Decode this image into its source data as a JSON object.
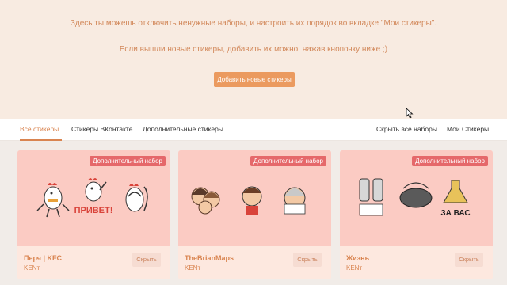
{
  "banner": {
    "line1": "Здесь ты можешь отключить ненужные наборы, и настроить их порядок во вкладке \"Мои стикеры\".",
    "line2": "Если вышли новые стикеры, добавить их можно, нажав кнопочку ниже ;)",
    "add_button": "Добавить новые стикеры"
  },
  "tabs": {
    "all": "Все стикеры",
    "vk": "Стикеры ВКонтакте",
    "extra": "Дополнительные стикеры",
    "hide_all": "Скрыть все наборы",
    "my": "Мои Стикеры"
  },
  "cards": [
    {
      "badge": "Дополнительный набор",
      "title": "Перч | KFC",
      "author": "KENт",
      "hide": "Скрыть",
      "caption": "ПРИВЕТ!"
    },
    {
      "badge": "Дополнительный набор",
      "title": "TheBrianMaps",
      "author": "KENт",
      "hide": "Скрыть",
      "caption": ""
    },
    {
      "badge": "Дополнительный набор",
      "title": "Жизнь",
      "author": "KENт",
      "hide": "Скрыть",
      "caption": "ЗА ВАС"
    }
  ],
  "colors": {
    "accent": "#d98450",
    "badge": "#e5686a",
    "banner_bg": "#f8ebe1",
    "card_img_bg": "#fbcbc3"
  }
}
